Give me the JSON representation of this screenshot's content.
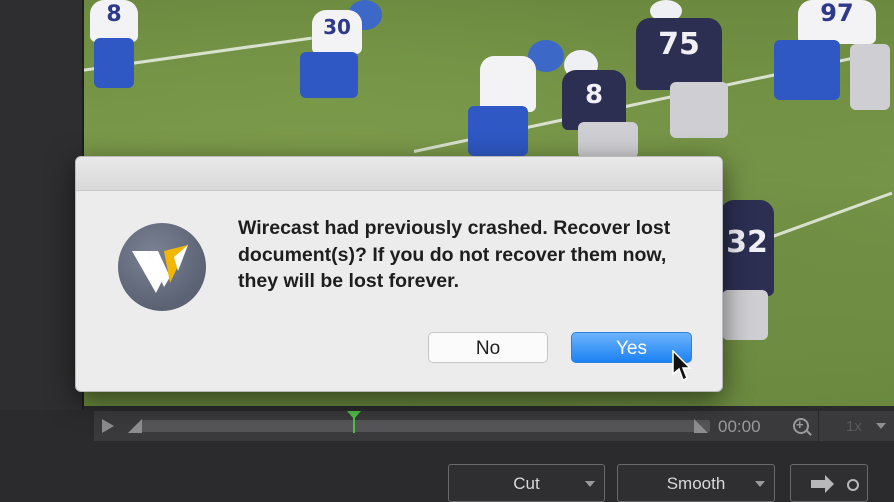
{
  "window": {
    "sidebar": "video-sources-panel"
  },
  "preview": {
    "players": [
      {
        "number": "8",
        "team": "white"
      },
      {
        "number": "30",
        "team": "white"
      },
      {
        "number": "8",
        "team": "navy"
      },
      {
        "number": "75",
        "team": "navy"
      },
      {
        "number": "97",
        "team": "white"
      },
      {
        "number": "32",
        "team": "navy"
      }
    ]
  },
  "dialog": {
    "icon": "wirecast-logo-icon",
    "message": "Wirecast had previously crashed. Recover lost document(s)? If you do not recover them now, they will be lost forever.",
    "no_label": "No",
    "yes_label": "Yes"
  },
  "transport": {
    "timecode": "00:00",
    "speed": "1x"
  },
  "controls": {
    "transition_label": "Cut",
    "smoothing_label": "Smooth",
    "go_icon": "arrow-right-icon"
  },
  "colors": {
    "accent": "#1c82f4",
    "playhead": "#4fbf4a"
  }
}
